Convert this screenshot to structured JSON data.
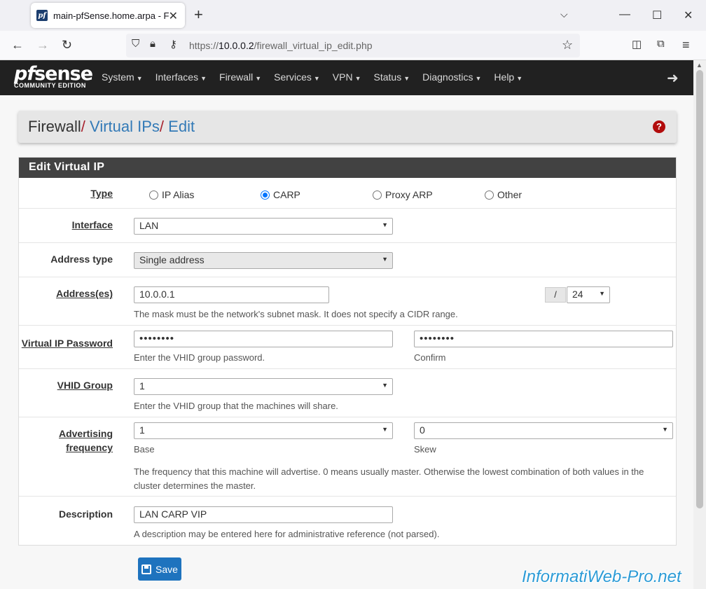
{
  "browser": {
    "tab_title": "main-pfSense.home.arpa - Fire",
    "favicon_text": "pf",
    "url_prefix": "https://",
    "url_host": "10.0.0.2",
    "url_path": "/firewall_virtual_ip_edit.php"
  },
  "nav": {
    "logo_main_pf": "pf",
    "logo_main_sense": "sense",
    "logo_sub": "COMMUNITY EDITION",
    "menu": [
      "System",
      "Interfaces",
      "Firewall",
      "Services",
      "VPN",
      "Status",
      "Diagnostics",
      "Help"
    ]
  },
  "breadcrumb": {
    "root": "Firewall",
    "sep": "/",
    "level2": "Virtual IPs",
    "level3": "Edit"
  },
  "panel": {
    "heading": "Edit Virtual IP"
  },
  "form": {
    "type": {
      "label": "Type",
      "options": [
        "IP Alias",
        "CARP",
        "Proxy ARP",
        "Other"
      ],
      "selected": "CARP"
    },
    "interface": {
      "label": "Interface",
      "value": "LAN"
    },
    "address_type": {
      "label": "Address type",
      "value": "Single address"
    },
    "addresses": {
      "label": "Address(es)",
      "value": "10.0.0.1",
      "slash": "/",
      "mask": "24",
      "help": "The mask must be the network's subnet mask. It does not specify a CIDR range."
    },
    "vip_password": {
      "label": "Virtual IP Password",
      "password_mask": "••••••••",
      "confirm_mask": "••••••••",
      "help": "Enter the VHID group password.",
      "confirm_help": "Confirm"
    },
    "vhid_group": {
      "label": "VHID Group",
      "value": "1",
      "help": "Enter the VHID group that the machines will share."
    },
    "advertising": {
      "label_line1": "Advertising",
      "label_line2": "frequency",
      "base_value": "1",
      "base_help": "Base",
      "skew_value": "0",
      "skew_help": "Skew",
      "help": "The frequency that this machine will advertise. 0 means usually master. Otherwise the lowest combination of both values in the cluster determines the master."
    },
    "description": {
      "label": "Description",
      "value": "LAN CARP VIP",
      "help": "A description may be entered here for administrative reference (not parsed)."
    },
    "save_label": "Save"
  },
  "watermark": "InformatiWeb-Pro.net",
  "colors": {
    "nav_bg": "#212121",
    "panel_heading_bg": "#424242",
    "link": "#337ab7",
    "breadcrumb_sep": "#a8242f",
    "save_button": "#1e73be",
    "help_icon": "#b20c0c"
  }
}
